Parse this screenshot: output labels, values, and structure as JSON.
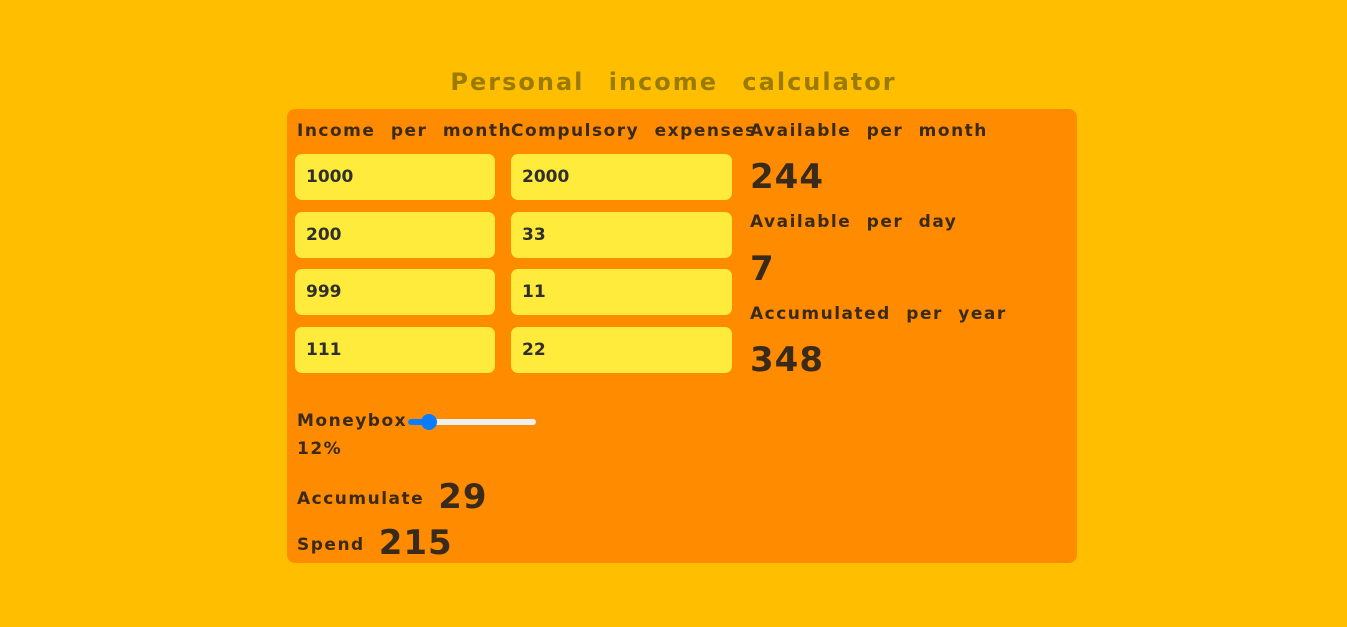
{
  "title": "Personal income calculator",
  "columns": {
    "income_label": "Income per month",
    "expenses_label": "Compulsory expenses"
  },
  "income_values": [
    "1000",
    "200",
    "999",
    "111"
  ],
  "expense_values": [
    "2000",
    "33",
    "11",
    "22"
  ],
  "results": {
    "available_month_label": "Available per month",
    "available_month_value": "244",
    "available_day_label": "Available per day",
    "available_day_value": "7",
    "accumulated_year_label": "Accumulated per year",
    "accumulated_year_value": "348"
  },
  "moneybox": {
    "label": "Moneybox",
    "percent_text": "12%",
    "percent": 12,
    "accumulate_label": "Accumulate",
    "accumulate_value": "29",
    "spend_label": "Spend",
    "spend_value": "215"
  },
  "colors": {
    "background": "#ffbf00",
    "panel": "#ff8c00",
    "field": "#ffeb3b",
    "accent": "#0a7dff",
    "title": "#9a7a00"
  }
}
